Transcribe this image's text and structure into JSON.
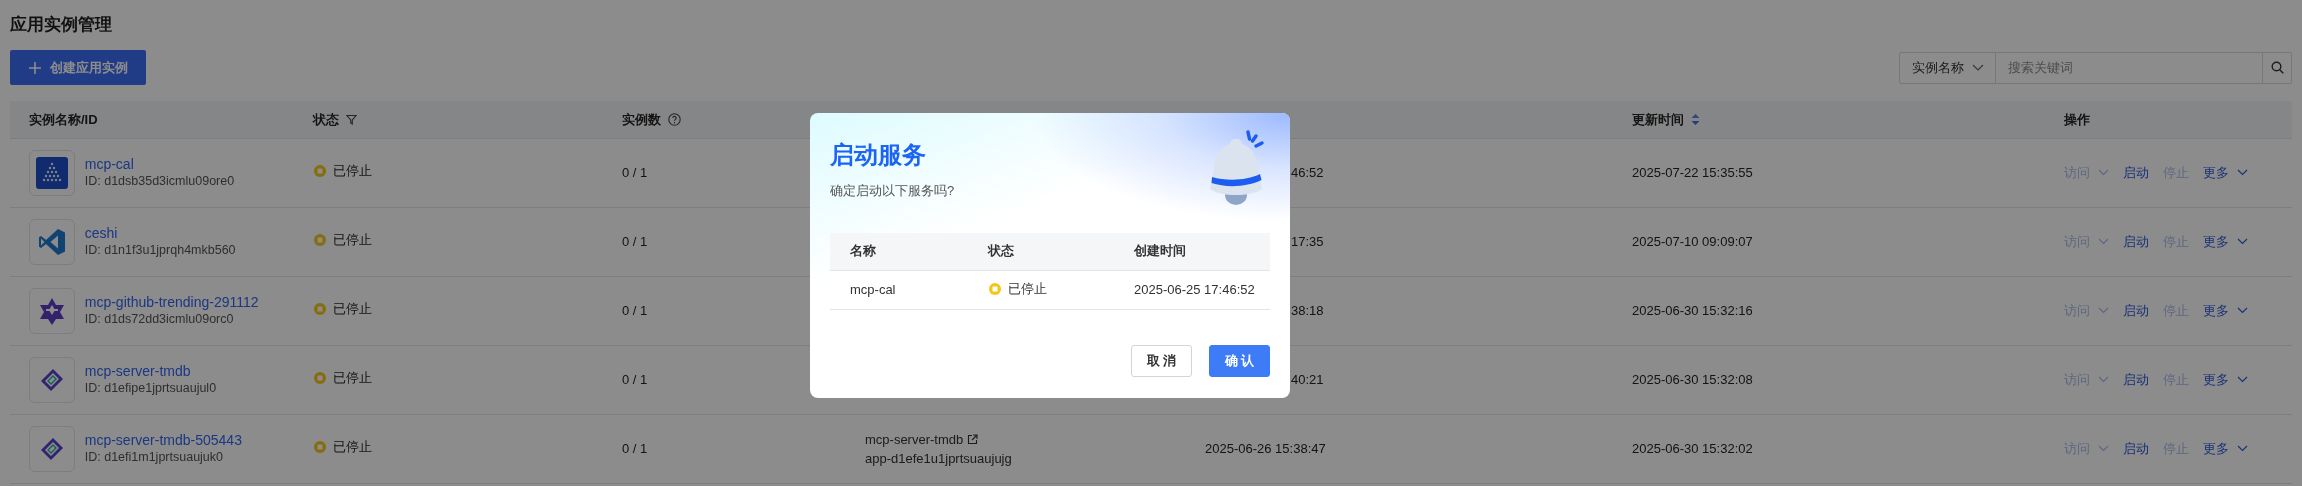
{
  "page": {
    "title": "应用实例管理"
  },
  "create_button": {
    "label": "创建应用实例"
  },
  "search": {
    "filter_label": "实例名称",
    "placeholder": "搜索关键词"
  },
  "table": {
    "columns": [
      {
        "label": "实例名称/ID",
        "kind": "plain"
      },
      {
        "label": "状态",
        "kind": "filter"
      },
      {
        "label": "实例数",
        "kind": "help"
      },
      {
        "label": "更新时间",
        "kind": "sort"
      },
      {
        "label": "操作",
        "kind": "plain"
      }
    ],
    "rows": [
      {
        "name": "mcp-cal",
        "id": "ID: d1dsb35d3icmlu09ore0",
        "status": "已停止",
        "instances": "0 / 1",
        "created": "46:52",
        "updated": "2025-07-22 15:35:55",
        "actions": [
          {
            "label": "访问",
            "kind": "dropdown",
            "disabled": true
          },
          {
            "label": "启动",
            "kind": "link",
            "disabled": false
          },
          {
            "label": "停止",
            "kind": "link",
            "disabled": true
          },
          {
            "label": "更多",
            "kind": "dropdown",
            "disabled": false
          }
        ]
      },
      {
        "name": "ceshi",
        "id": "ID: d1n1f3u1jprqh4mkb560",
        "status": "已停止",
        "instances": "0 / 1",
        "created": "17:35",
        "updated": "2025-07-10 09:09:07",
        "actions": [
          {
            "label": "访问",
            "kind": "dropdown",
            "disabled": true
          },
          {
            "label": "启动",
            "kind": "link",
            "disabled": false
          },
          {
            "label": "停止",
            "kind": "link",
            "disabled": true
          },
          {
            "label": "更多",
            "kind": "dropdown",
            "disabled": false
          }
        ]
      },
      {
        "name": "mcp-github-trending-291112",
        "id": "ID: d1ds72dd3icmlu09orc0",
        "status": "已停止",
        "instances": "0 / 1",
        "created": "38:18",
        "updated": "2025-06-30 15:32:16",
        "actions": [
          {
            "label": "访问",
            "kind": "dropdown",
            "disabled": true
          },
          {
            "label": "启动",
            "kind": "link",
            "disabled": false
          },
          {
            "label": "停止",
            "kind": "link",
            "disabled": true
          },
          {
            "label": "更多",
            "kind": "dropdown",
            "disabled": false
          }
        ]
      },
      {
        "name": "mcp-server-tmdb",
        "id": "ID: d1efipe1jprtsuaujul0",
        "status": "已停止",
        "instances": "0 / 1",
        "created": "40:21",
        "updated": "2025-06-30 15:32:08",
        "actions": [
          {
            "label": "访问",
            "kind": "dropdown",
            "disabled": true
          },
          {
            "label": "启动",
            "kind": "link",
            "disabled": false
          },
          {
            "label": "停止",
            "kind": "link",
            "disabled": true
          },
          {
            "label": "更多",
            "kind": "dropdown",
            "disabled": false
          }
        ]
      },
      {
        "name": "mcp-server-tmdb-505443",
        "id": "ID: d1efi1m1jprtsuaujuk0",
        "status": "已停止",
        "instances": "0 / 1",
        "service": "mcp-server-tmdb",
        "app_id": "app-d1efe1u1jprtsuaujujg",
        "created": "2025-06-26 15:38:47",
        "updated": "2025-06-30 15:32:02",
        "actions": [
          {
            "label": "访问",
            "kind": "dropdown",
            "disabled": true
          },
          {
            "label": "启动",
            "kind": "link",
            "disabled": false
          },
          {
            "label": "停止",
            "kind": "link",
            "disabled": true
          },
          {
            "label": "更多",
            "kind": "dropdown",
            "disabled": false
          }
        ]
      }
    ]
  },
  "dialog": {
    "title": "启动服务",
    "message": "确定启动以下服务吗?",
    "columns": [
      "名称",
      "状态",
      "创建时间"
    ],
    "rows": [
      {
        "name": "mcp-cal",
        "status": "已停止",
        "created": "2025-06-25 17:46:52"
      }
    ],
    "buttons": [
      {
        "label": "取 消",
        "kind": "secondary"
      },
      {
        "label": "确 认",
        "kind": "primary"
      }
    ]
  }
}
